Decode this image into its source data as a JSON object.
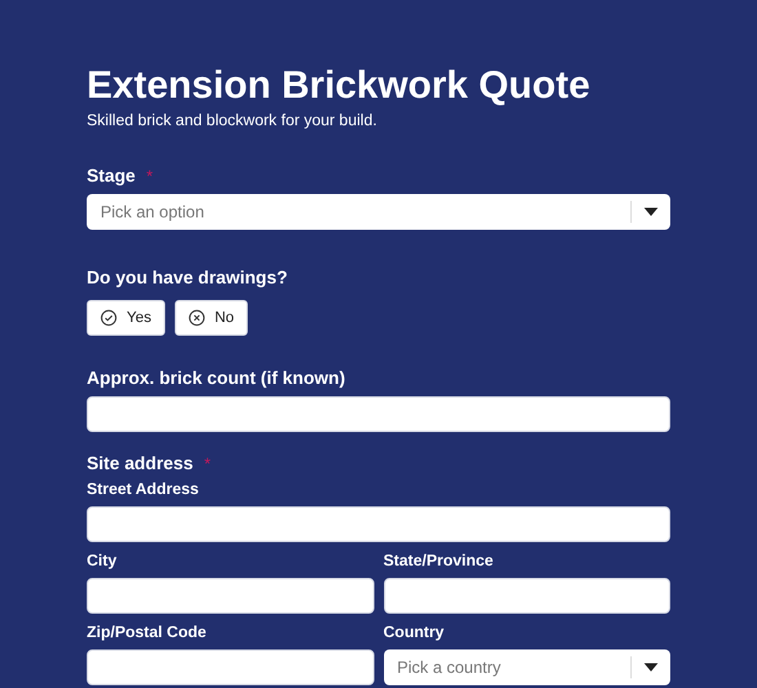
{
  "title": "Extension Brickwork Quote",
  "subtitle": "Skilled brick and blockwork for your build.",
  "stage": {
    "label": "Stage",
    "required_mark": "*",
    "placeholder": "Pick an option"
  },
  "drawings": {
    "label": "Do you have drawings?",
    "options": [
      {
        "label": "Yes",
        "kind": "yes",
        "selected": false
      },
      {
        "label": "No",
        "kind": "no",
        "selected": false
      }
    ]
  },
  "brick_count": {
    "label": "Approx. brick count (if known)"
  },
  "site_address": {
    "label": "Site address",
    "required_mark": "*",
    "street": {
      "label": "Street Address"
    },
    "city": {
      "label": "City"
    },
    "state": {
      "label": "State/Province"
    },
    "zip": {
      "label": "Zip/Postal Code"
    },
    "country": {
      "label": "Country",
      "placeholder": "Pick a country"
    }
  }
}
